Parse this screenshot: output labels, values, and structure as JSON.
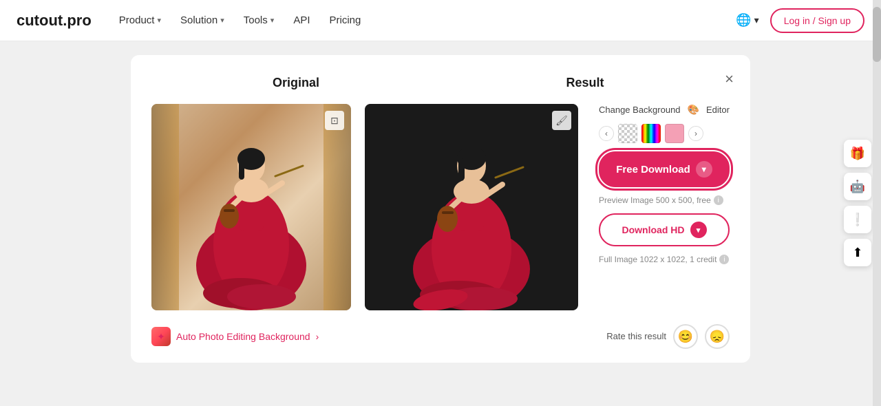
{
  "brand": {
    "logo": "cutout.pro"
  },
  "navbar": {
    "product_label": "Product",
    "solution_label": "Solution",
    "tools_label": "Tools",
    "api_label": "API",
    "pricing_label": "Pricing",
    "login_label": "Log in / Sign up",
    "lang_icon": "🌐"
  },
  "panel": {
    "original_label": "Original",
    "result_label": "Result",
    "close_label": "×"
  },
  "controls": {
    "change_bg_label": "Change Background",
    "editor_label": "Editor",
    "prev_label": "‹",
    "next_label": "›"
  },
  "buttons": {
    "free_download_label": "Free Download",
    "preview_text": "Preview Image 500 x 500, free",
    "download_hd_label": "Download HD",
    "full_image_text": "Full Image 1022 x 1022, 1 credit"
  },
  "bottom": {
    "auto_photo_label": "Auto Photo Editing Background",
    "auto_photo_arrow": "›",
    "rate_label": "Rate this result"
  },
  "float_sidebar": {
    "gift_icon": "🎁",
    "avatar_icon": "🤖",
    "alert_icon": "❕",
    "upload_icon": "⬆"
  }
}
